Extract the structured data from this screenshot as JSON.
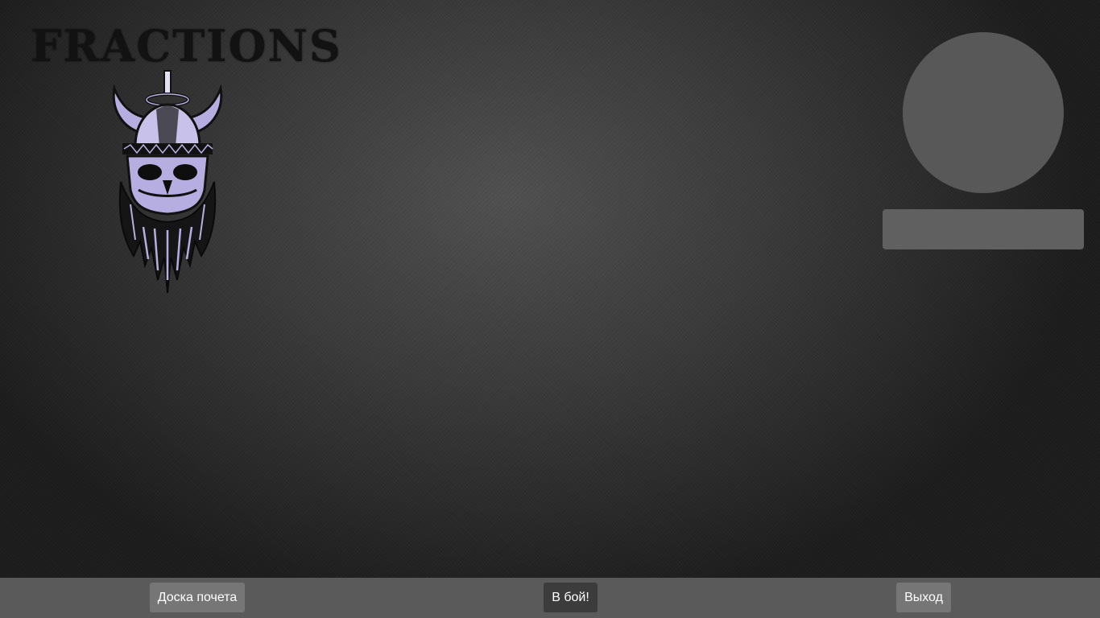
{
  "header": {
    "title": "FRACTIONS",
    "emblem_icon": "viking-skull-icon"
  },
  "profile": {
    "avatar_icon": "avatar-placeholder",
    "username": ""
  },
  "bottom_bar": {
    "honor_board_label": "Доска почета",
    "battle_label": "В бой!",
    "exit_label": "Выход"
  },
  "colors": {
    "emblem_accent": "#b6aee0",
    "title_color": "#121212",
    "bar_color": "#5a5a5a"
  }
}
